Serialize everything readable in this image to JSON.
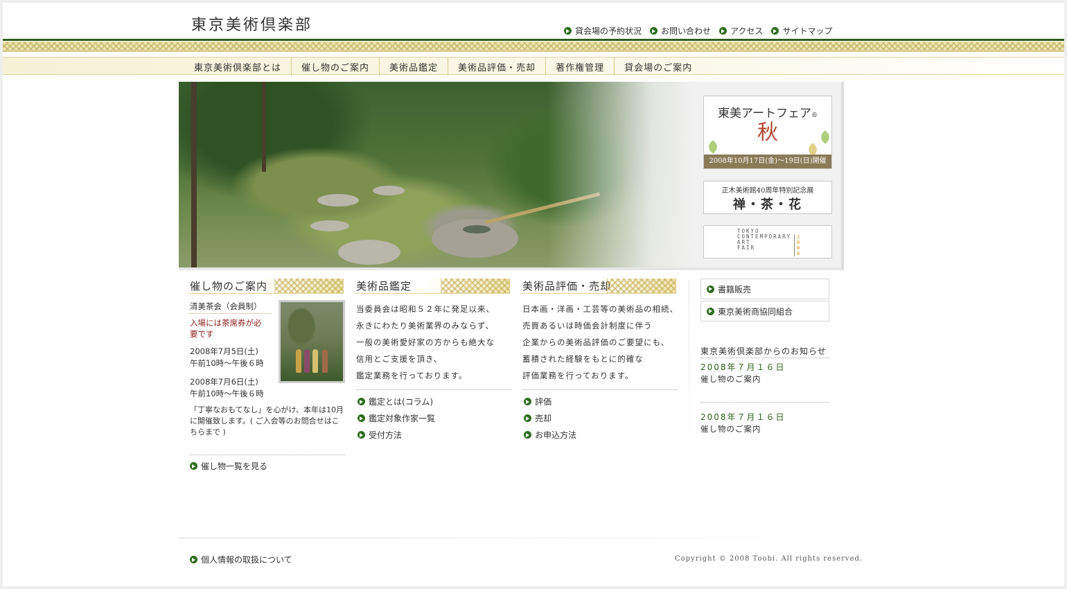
{
  "header": {
    "logo": "東京美術倶楽部",
    "top_links": [
      "貸会場の予約状況",
      "お問い合わせ",
      "アクセス",
      "サイトマップ"
    ]
  },
  "nav": {
    "items": [
      "東京美術倶楽部とは",
      "催し物のご案内",
      "美術品鑑定",
      "美術品評価・売却",
      "著作権管理",
      "貸会場のご案内"
    ]
  },
  "banners": {
    "artfair": {
      "title": "東美アートフェア",
      "reg": "®",
      "season": "秋",
      "date": "2008年10月17日(金)～19日(日)開催"
    },
    "masaki": {
      "sub": "正木美術館40周年特別記念展",
      "main": "禅・茶・花"
    },
    "tcaf": {
      "line1": "TOKYO",
      "line2": "CONTEMPORARY",
      "line3": "ART",
      "line4": "FAIR",
      "year": "2008"
    }
  },
  "events": {
    "heading": "催し物のご案内",
    "title": "清美茶会（会員制）",
    "notice": "入場には茶席券が必要です",
    "date1": "2008年7月5日(土)",
    "time1": "午前10時～午後６時",
    "date2": "2008年7月6日(土)",
    "time2": "午前10時～午後６時",
    "desc": "「丁寧なおもてなし」を心がけ、本年は10月に開催致します。( ご入会等のお問合せはこちらまで )",
    "more_link": "催し物一覧を見る"
  },
  "appraisal": {
    "heading": "美術品鑑定",
    "lines": [
      "当委員会は昭和５２年に発足以来、",
      "永きにわたり美術業界のみならず、",
      "一般の美術愛好家の方からも絶大な",
      "信用とご支援を頂き、",
      "鑑定業務を行っております。"
    ],
    "links": [
      "鑑定とは(コラム)",
      "鑑定対象作家一覧",
      "受付方法"
    ]
  },
  "evaluation": {
    "heading": "美術品評価・売却",
    "lines": [
      "日本画・洋画・工芸等の美術品の相続、",
      "売買あるいは時価会計制度に伴う",
      "企業からの美術品評価のご要望にも、",
      "蓄積された経験をもとに的確な",
      "評価業務を行っております。"
    ],
    "links": [
      "評価",
      "売却",
      "お申込方法"
    ]
  },
  "sidebar": {
    "buttons": [
      "書籍販売",
      "東京美術商協同組合"
    ],
    "news_heading": "東京美術倶楽部からのお知らせ",
    "news": [
      {
        "date": "2008年７月１６日",
        "title": "催し物のご案内"
      },
      {
        "date": "2008年７月１６日",
        "title": "催し物のご案内"
      }
    ]
  },
  "footer": {
    "privacy_link": "個人情報の取扱について",
    "copyright": "Copyright © 2008 Toobi. All rights reserved."
  },
  "colors": {
    "accent_green": "#2f5d1d",
    "gold_band": "#ece5b3",
    "notice_red": "#8a1c1c"
  }
}
